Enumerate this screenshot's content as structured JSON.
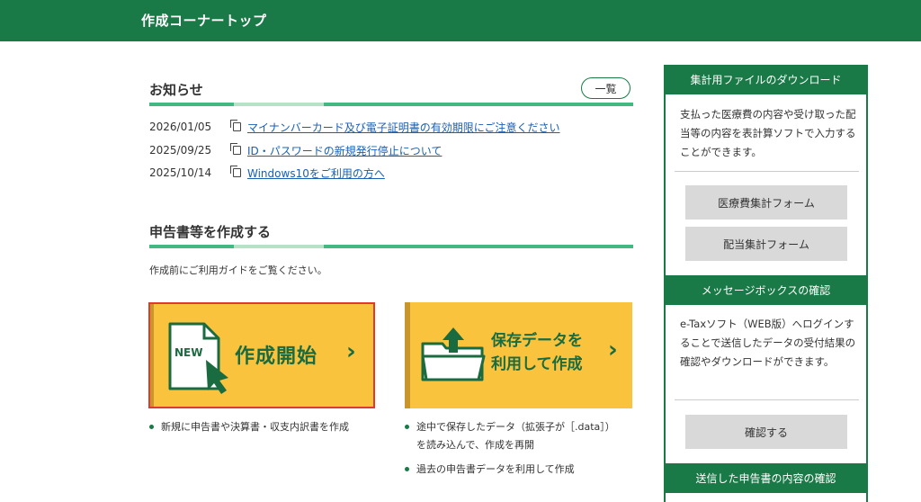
{
  "header": {
    "title": "作成コーナートップ"
  },
  "news": {
    "title": "お知らせ",
    "list_button": "一覧",
    "items": [
      {
        "date": "2026/01/05",
        "text": "マイナンバーカード及び電子証明書の有効期限にご注意ください"
      },
      {
        "date": "2025/09/25",
        "text": "ID・パスワードの新規発行停止について"
      },
      {
        "date": "2025/10/14",
        "text": "Windows10をご利用の方へ"
      }
    ]
  },
  "create": {
    "title": "申告書等を作成する",
    "guide": "作成前にご利用ガイドをご覧ください。",
    "new_card": {
      "icon_text": "NEW",
      "label": "作成開始"
    },
    "load_card": {
      "label_line1": "保存データを",
      "label_line2": "利用して作成"
    },
    "new_bullets": [
      "新規に申告書や決算書・収支内訳書を作成"
    ],
    "load_bullets": [
      {
        "line1": "途中で保存したデータ（拡張子が［.data］）",
        "line2": "を読み込んで、作成を再開"
      },
      {
        "line1": "過去の申告書データを利用して作成"
      }
    ]
  },
  "sidebar": {
    "download": {
      "header": "集計用ファイルのダウンロード",
      "text": "支払った医療費の内容や受け取った配当等の内容を表計算ソフトで入力することができます。",
      "buttons": [
        "医療費集計フォーム",
        "配当集計フォーム"
      ]
    },
    "message": {
      "header": "メッセージボックスの確認",
      "text": "e-Taxソフト（WEB版）へログインすることで送信したデータの受付結果の確認やダウンロードができます。",
      "button": "確認する"
    },
    "sent": {
      "header": "送信した申告書の内容の確認"
    }
  },
  "colors": {
    "brand_green": "#1a7a47",
    "accent_green": "#42b883",
    "card_yellow": "#f9c33d",
    "link_blue": "#1a5fb4"
  }
}
